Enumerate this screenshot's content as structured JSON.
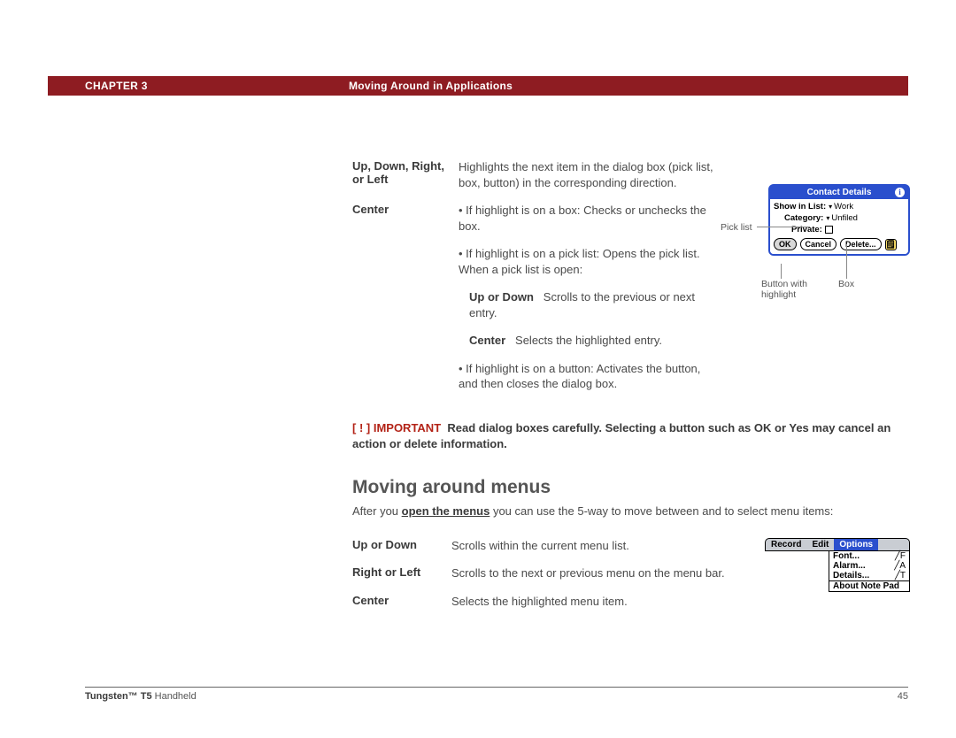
{
  "header": {
    "chapter_label": "CHAPTER 3",
    "section_title": "Moving Around in Applications"
  },
  "definitions1": {
    "row1_term": "Up, Down, Right, or Left",
    "row1_desc": "Highlights the next item in the dialog box (pick list, box, button) in the corresponding direction.",
    "row2_term": "Center",
    "row2_bullet1": "If highlight is on a box: Checks or unchecks the box.",
    "row2_bullet2": "If highlight is on a pick list: Opens the pick list. When a pick list is open:",
    "row2_sub1_label": "Up or Down",
    "row2_sub1_text": "Scrolls to the previous or next entry.",
    "row2_sub2_label": "Center",
    "row2_sub2_text": "Selects the highlighted entry.",
    "row2_bullet3": "If highlight is on a button: Activates the button, and then closes the dialog box."
  },
  "important": {
    "tag_brackets": "[ ! ] ",
    "tag": "IMPORTANT",
    "text": "Read dialog boxes carefully. Selecting a button such as OK or Yes may cancel an action or delete information."
  },
  "heading2": "Moving around menus",
  "para_prefix": "After you ",
  "para_link": "open the menus",
  "para_suffix": " you can use the 5-way to move between and to select menu items:",
  "definitions2": {
    "r1_term": "Up or Down",
    "r1_desc": "Scrolls within the current menu list.",
    "r2_term": "Right or Left",
    "r2_desc": "Scrolls to the next or previous menu on the menu bar.",
    "r3_term": "Center",
    "r3_desc": "Selects the highlighted menu item."
  },
  "palm_dialog": {
    "title": "Contact Details",
    "row1_label": "Show in List:",
    "row1_value": "Work",
    "row2_label": "Category:",
    "row2_value": "Unfiled",
    "row3_label": "Private:",
    "btn_ok": "OK",
    "btn_cancel": "Cancel",
    "btn_delete": "Delete...",
    "note_glyph": "🗒"
  },
  "callouts": {
    "picklist": "Pick list",
    "button_highlight": "Button with highlight",
    "box": "Box"
  },
  "palm_menu": {
    "tab1": "Record",
    "tab2": "Edit",
    "tab3": "Options",
    "item1": "Font...",
    "item1_sc": "╱F",
    "item2": "Alarm...",
    "item2_sc": "╱A",
    "item3": "Details...",
    "item3_sc": "╱T",
    "item4": "About Note Pad"
  },
  "footer": {
    "product_bold": "Tungsten™ T5",
    "product_rest": " Handheld",
    "page": "45"
  }
}
